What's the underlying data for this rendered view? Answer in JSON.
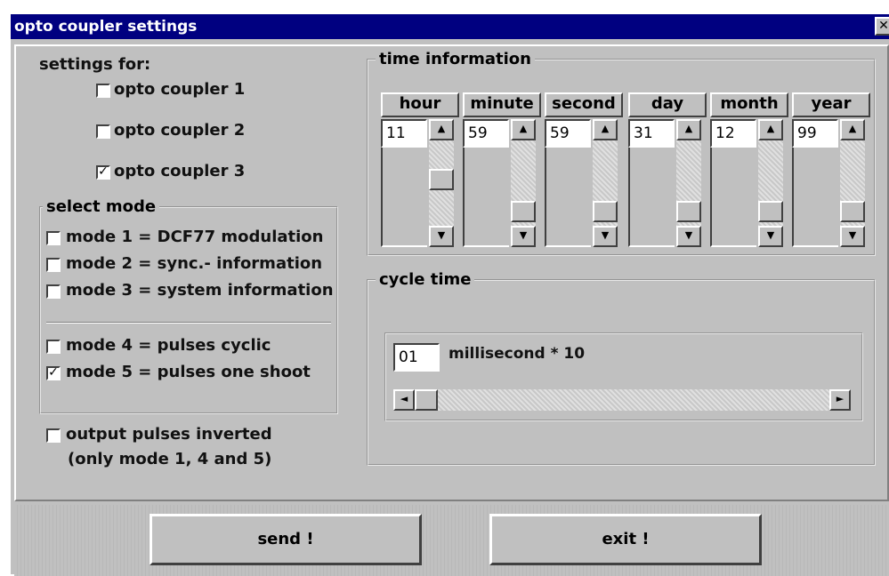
{
  "window": {
    "title": "opto coupler settings",
    "close_glyph": "✕"
  },
  "settings_for": {
    "label": "settings for:",
    "options": [
      {
        "label": "opto coupler 1",
        "checked": false
      },
      {
        "label": "opto coupler 2",
        "checked": false
      },
      {
        "label": "opto coupler 3",
        "checked": true
      }
    ]
  },
  "select_mode": {
    "label": "select mode",
    "options": [
      {
        "label": "mode 1 = DCF77 modulation",
        "checked": false
      },
      {
        "label": "mode 2 = sync.- information",
        "checked": false
      },
      {
        "label": "mode 3 = system information",
        "checked": false
      },
      {
        "label": "mode 4 = pulses cyclic",
        "checked": false
      },
      {
        "label": "mode 5 = pulses one shoot",
        "checked": true
      }
    ]
  },
  "output_inverted": {
    "label": "output pulses inverted",
    "note": "(only mode 1, 4 and 5)",
    "checked": false
  },
  "time_information": {
    "label": "time information",
    "fields": [
      {
        "label": "hour",
        "value": "11"
      },
      {
        "label": "minute",
        "value": "59"
      },
      {
        "label": "second",
        "value": "59"
      },
      {
        "label": "day",
        "value": "31"
      },
      {
        "label": "month",
        "value": "12"
      },
      {
        "label": "year",
        "value": "99"
      }
    ],
    "arrow_up": "▲",
    "arrow_down": "▼"
  },
  "cycle_time": {
    "label": "cycle time",
    "value": "01",
    "unit": "millisecond * 10",
    "arrow_left": "◄",
    "arrow_right": "►"
  },
  "buttons": {
    "send": "send !",
    "exit": "exit !"
  },
  "check_glyph": "✓"
}
